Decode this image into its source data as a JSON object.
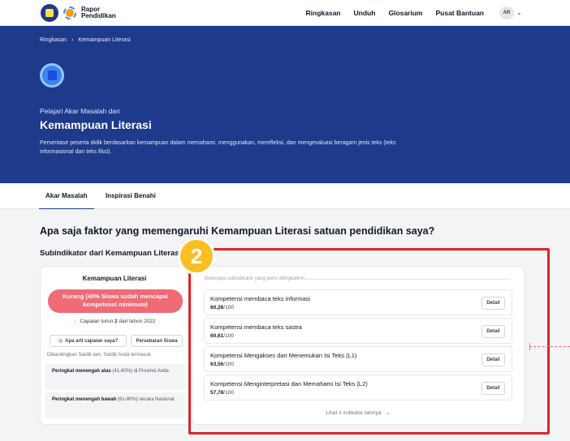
{
  "brand": {
    "line1": "Rapor",
    "line2": "Pendidikan"
  },
  "nav": {
    "links": [
      "Ringkasan",
      "Unduh",
      "Glosarium",
      "Pusat Bantuan"
    ],
    "avatar": "AR"
  },
  "hero": {
    "breadcrumb": [
      "Ringkasan",
      "Kemampuan Literasi"
    ],
    "subtitle": "Pelajari Akar Masalah dari",
    "title": "Kemampuan Literasi",
    "description": "Persentase peserta didik berdasarkan kemampuan dalam memahami, menggunakan, merefleksi, dan mengevaluasi beragam jenis teks (teks informasional dan teks fiksi)."
  },
  "tabs": [
    "Akar Masalah",
    "Inspirasi Benahi"
  ],
  "main": {
    "question": "Apa saja faktor yang memengaruhi Kemampuan Literasi satuan pendidikan saya?",
    "subheading": "Subindikator dari Kemampuan Literasi",
    "left_card": {
      "title": "Kemampuan Literasi",
      "status": "Kurang (40% Siswa sudah mencapai kompetensi minimum)",
      "trend_prefix": "Capaian turun",
      "trend_value": "2",
      "trend_suffix": "dari tahun 2022",
      "button_meaning": "Apa arti capaian saya?",
      "button_distribution": "Persebaran Siswa",
      "compare_note": "Dibandingkan Satdik lain, Satdik Anda termasuk",
      "rank1_bold": "Peringkat menengah atas",
      "rank1_rest": "(41-60%) di Provinsi Anda",
      "rank2_bold": "Peringkat menengah bawah",
      "rank2_rest": "(61-80%) secara Nasional"
    },
    "right_card": {
      "heading": "Beberapa subindikator yang perlu ditingkatkan",
      "rows": [
        {
          "name": "Kompetensi membaca teks informasi",
          "score": "60,26",
          "max": "/100",
          "action": "Detail"
        },
        {
          "name": "Kompetensi membaca teks sastra",
          "score": "60,61",
          "max": "/100",
          "action": "Detail"
        },
        {
          "name": "Kompetensi Mengakses dan Menemukan Isi Teks (L1)",
          "score": "63,56",
          "max": "/100",
          "action": "Detail"
        },
        {
          "name": "Kompetensi Menginterpretasi dan Memahami Isi Teks (L2)",
          "score": "57,78",
          "max": "/100",
          "action": "Detail"
        }
      ],
      "more": "Lihat 1 indikator lainnya"
    }
  },
  "annotation": {
    "marker": "2",
    "color": "#dc2626",
    "marker_color": "#fbbf24"
  }
}
